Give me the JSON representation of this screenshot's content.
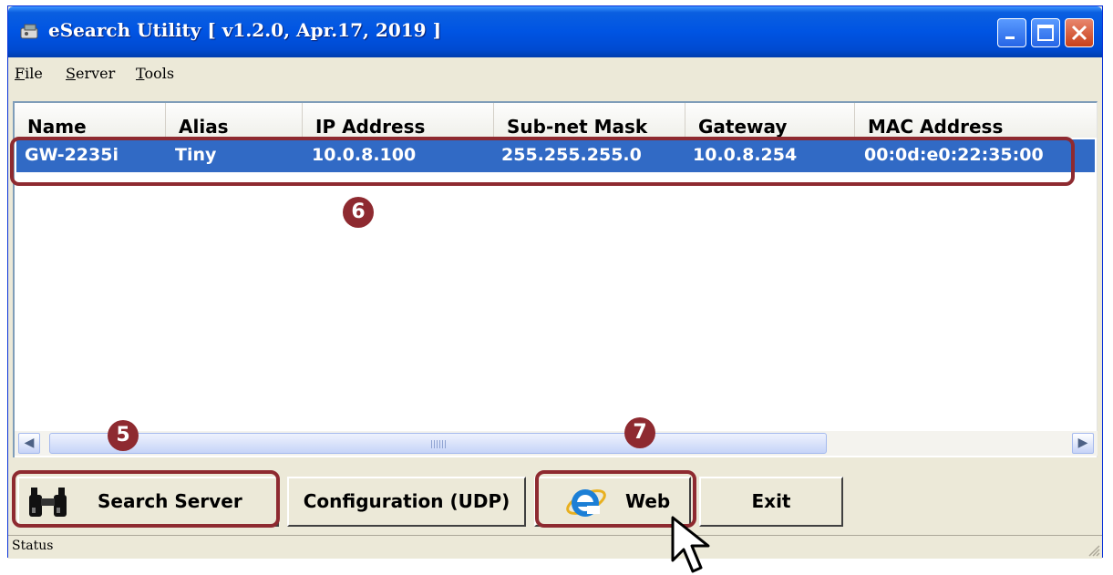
{
  "window": {
    "title": "eSearch Utility [ v1.2.0, Apr.17, 2019 ]"
  },
  "menu": [
    "File",
    "Server",
    "Tools"
  ],
  "table": {
    "columns": [
      "Name",
      "Alias",
      "IP Address",
      "Sub-net Mask",
      "Gateway",
      "MAC Address"
    ],
    "rows": [
      [
        "GW-2235i",
        "Tiny",
        "10.0.8.100",
        "255.255.255.0",
        "10.0.8.254",
        "00:0d:e0:22:35:00"
      ]
    ]
  },
  "buttons": {
    "search": "Search Server",
    "config": "Configuration (UDP)",
    "web": "Web",
    "exit": "Exit"
  },
  "callouts": [
    "6",
    "5",
    "7"
  ],
  "status": "Status",
  "icons": [
    "app-icon",
    "minimize-icon",
    "maximize-icon",
    "close-icon",
    "binoculars-icon",
    "internet-explorer-icon",
    "mouse-pointer-icon",
    "resize-grip-icon"
  ],
  "colors": {
    "selection": "#316ac5",
    "highlight_box": "#8e2a30",
    "titlebar": "#0054e3"
  }
}
